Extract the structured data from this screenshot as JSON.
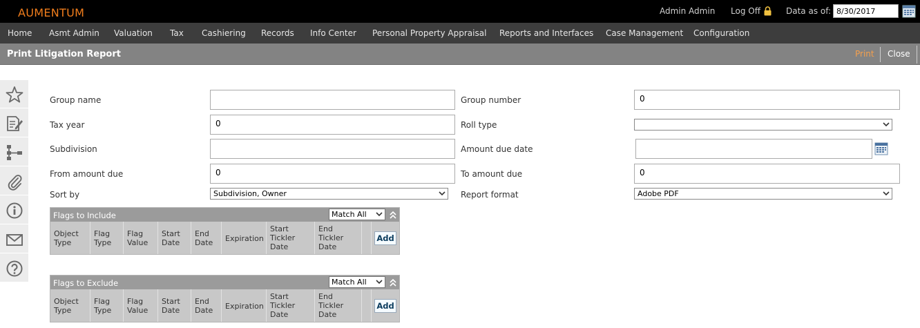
{
  "app": {
    "brand": "AUMENTUM",
    "user": "Admin Admin",
    "log_off": "Log Off",
    "data_as_of_label": "Data as of:",
    "data_as_of_value": "8/30/2017"
  },
  "nav": {
    "items": [
      "Home",
      "Asmt Admin",
      "Valuation",
      "Tax",
      "Cashiering",
      "Records",
      "Info Center",
      "Personal Property Appraisal",
      "Reports and Interfaces",
      "Case Management",
      "Configuration"
    ]
  },
  "page": {
    "title": "Print Litigation Report",
    "print_label": "Print",
    "close_label": "Close"
  },
  "sidebar": {
    "icons": [
      "star-icon",
      "edit-document-icon",
      "hierarchy-icon",
      "paperclip-icon",
      "info-icon",
      "mail-icon",
      "help-icon"
    ]
  },
  "form": {
    "group_name": {
      "label": "Group name",
      "value": ""
    },
    "group_number": {
      "label": "Group number",
      "value": "0"
    },
    "tax_year": {
      "label": "Tax year",
      "value": "0"
    },
    "roll_type": {
      "label": "Roll type",
      "value": ""
    },
    "subdivision": {
      "label": "Subdivision",
      "value": ""
    },
    "amount_due_date": {
      "label": "Amount due date",
      "value": ""
    },
    "from_amount_due": {
      "label": "From amount due",
      "value": "0"
    },
    "to_amount_due": {
      "label": "To amount due",
      "value": "0"
    },
    "sort_by": {
      "label": "Sort by",
      "value": "Subdivision, Owner"
    },
    "report_format": {
      "label": "Report format",
      "value": "Adobe PDF"
    }
  },
  "flags_include": {
    "title": "Flags to Include",
    "match": "Match All",
    "columns": [
      "Object\nType",
      "Flag\nType",
      "Flag\nValue",
      "Start\nDate",
      "End\nDate",
      "Expiration",
      "Start\nTickler\nDate",
      "End\nTickler\nDate"
    ],
    "add_label": "Add"
  },
  "flags_exclude": {
    "title": "Flags to Exclude",
    "match": "Match All",
    "columns": [
      "Object\nType",
      "Flag\nType",
      "Flag\nValue",
      "Start\nDate",
      "End\nDate",
      "Expiration",
      "Start\nTickler\nDate",
      "End\nTickler\nDate"
    ],
    "add_label": "Add"
  },
  "colors": {
    "brand": "#f07d1c",
    "topbar": "#000000",
    "nav": "#3d3d3d",
    "titlebar": "#838383",
    "print": "#f5a04d"
  }
}
